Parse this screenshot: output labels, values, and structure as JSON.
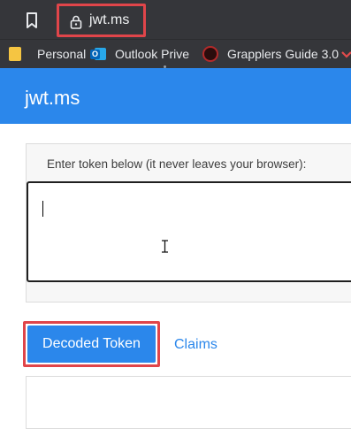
{
  "browser": {
    "url": "jwt.ms",
    "bookmarks": [
      {
        "label": "Personal",
        "icon": "folder-icon"
      },
      {
        "label": "Outlook Prive",
        "icon": "outlook-icon"
      },
      {
        "label": "Grapplers Guide 3.0",
        "icon": "grapplers-guide-icon"
      }
    ],
    "colors": {
      "chrome_bg": "#35363a",
      "highlight": "#e0454a"
    }
  },
  "app": {
    "title": "jwt.ms",
    "accent": "#2b87eb"
  },
  "token": {
    "label": "Enter token below (it never leaves your browser):",
    "value": ""
  },
  "tabs": [
    {
      "label": "Decoded Token",
      "active": true
    },
    {
      "label": "Claims",
      "active": false
    }
  ]
}
